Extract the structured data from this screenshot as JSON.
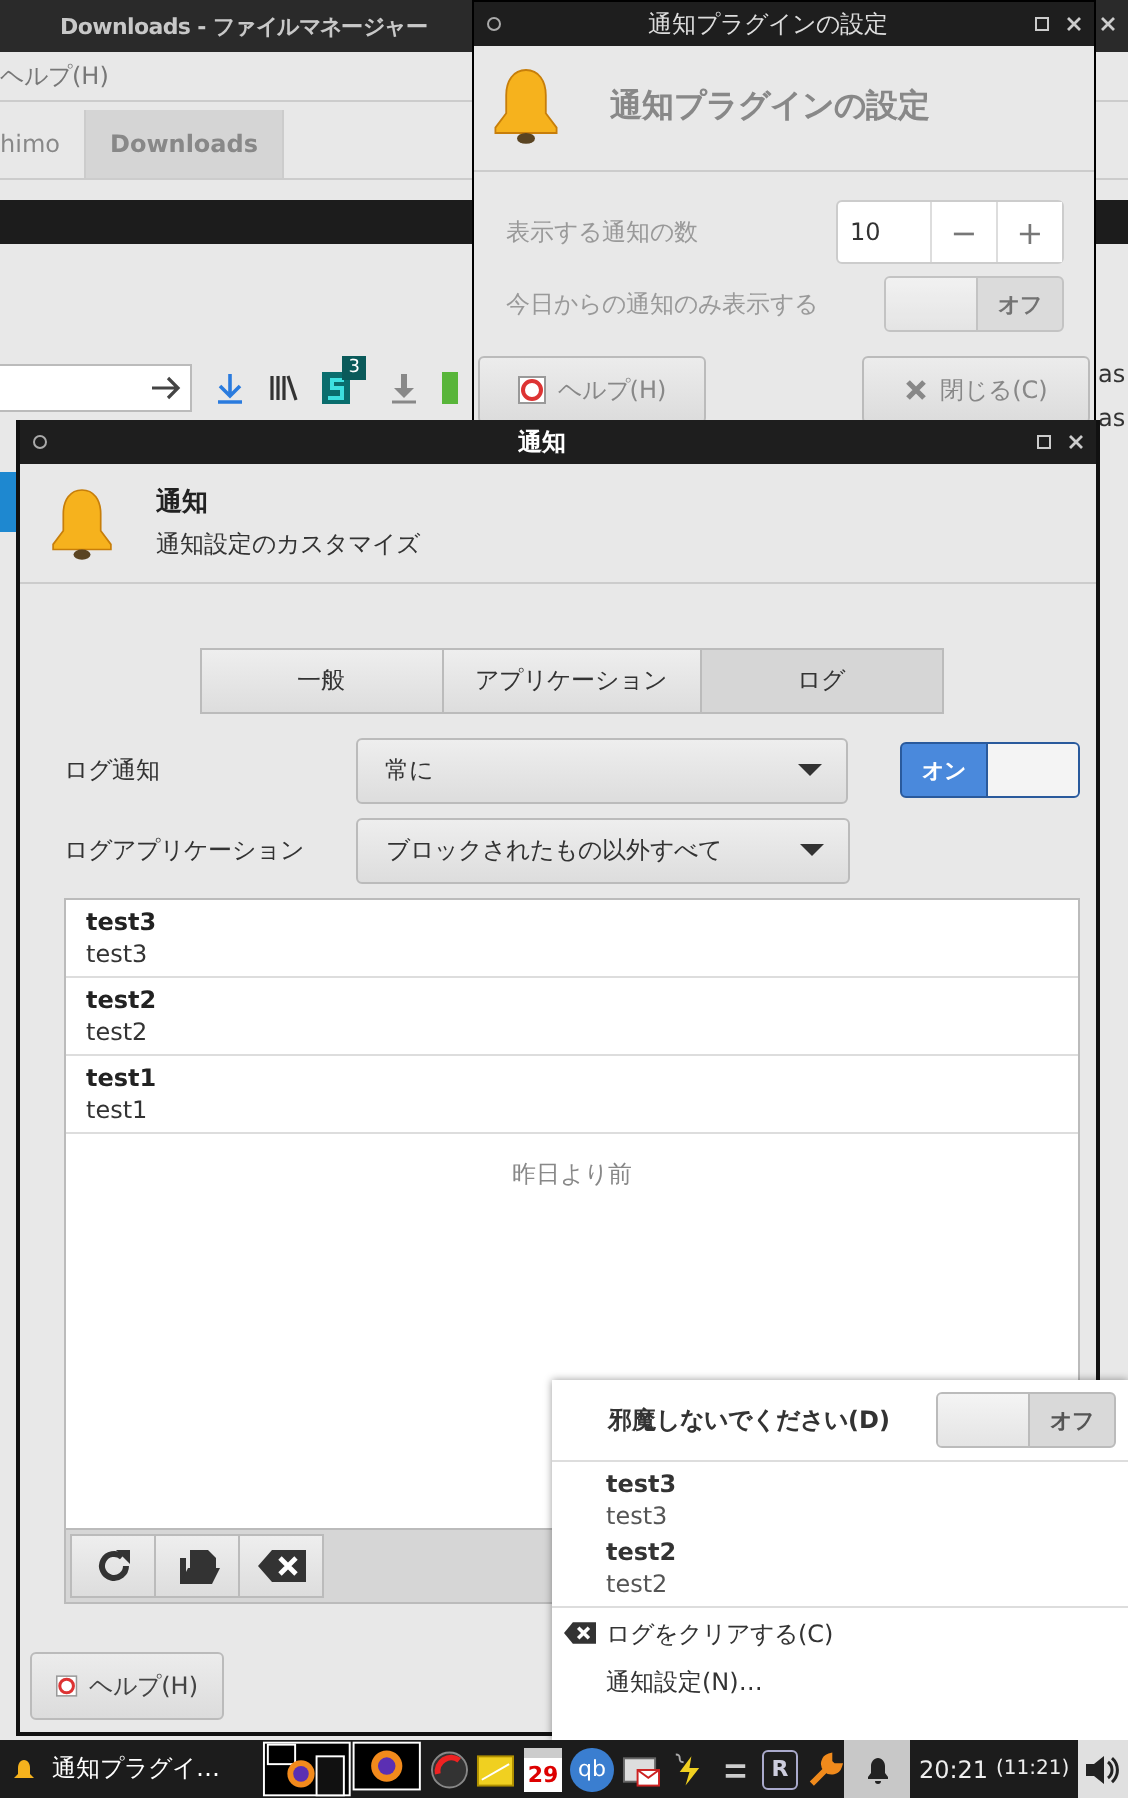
{
  "background_window": {
    "title": "Downloads - ファイルマネージャー",
    "menu": [
      "ヘルプ(H)"
    ],
    "tabs": [
      {
        "label": "himo",
        "selected": false
      },
      {
        "label": "Downloads",
        "selected": true
      }
    ],
    "badge": "3",
    "edge_texts": [
      "as",
      "as"
    ]
  },
  "plugin_window": {
    "title": "通知プラグインの設定",
    "heading": "通知プラグインの設定",
    "count_label": "表示する通知の数",
    "count_value": "10",
    "minus": "−",
    "plus": "+",
    "today_label": "今日からの通知のみ表示する",
    "today_switch": {
      "on": false,
      "label": "オフ"
    },
    "buttons": [
      {
        "label": "ヘルプ(H)",
        "kind": "help"
      },
      {
        "label": "閉じる(C)",
        "kind": "close"
      }
    ]
  },
  "main_window": {
    "title": "通知",
    "heading": "通知",
    "subheading": "通知設定のカスタマイズ",
    "tabs": [
      {
        "label": "一般",
        "selected": false
      },
      {
        "label": "アプリケーション",
        "selected": false
      },
      {
        "label": "ログ",
        "selected": true
      }
    ],
    "log_label": "ログ通知",
    "log_value": "常に",
    "log_switch": {
      "on": true,
      "label": "オン"
    },
    "apps_label": "ログアプリケーション",
    "apps_value": "ブロックされたもの以外すべて",
    "log": [
      {
        "title": "test3",
        "body": "test3"
      },
      {
        "title": "test2",
        "body": "test2"
      },
      {
        "title": "test1",
        "body": "test1"
      }
    ],
    "separator": "昨日より前",
    "help_button": "ヘルプ(H)"
  },
  "popup": {
    "dnd_label": "邪魔しないでください(D)",
    "dnd_switch": {
      "on": false,
      "label": "オフ"
    },
    "items": [
      {
        "title": "test3",
        "body": "test3"
      },
      {
        "title": "test2",
        "body": "test2"
      }
    ],
    "actions": [
      {
        "label": "ログをクリアする(C)",
        "kind": "clear"
      },
      {
        "label": "通知設定(N)…",
        "kind": "settings"
      }
    ]
  },
  "taskbar": {
    "task": "通知プラグイ…",
    "calendar_day": "29",
    "qb": "qb",
    "r": "R",
    "clock": "20:21",
    "clock_alt": "(11:21)"
  }
}
